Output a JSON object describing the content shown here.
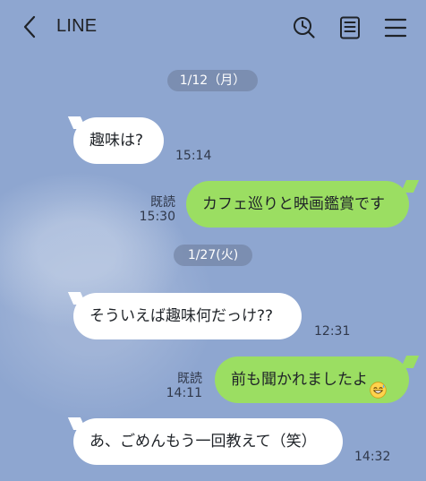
{
  "header": {
    "title": "LINE",
    "icons": {
      "back": "chevron-left-icon",
      "search": "clock-search-icon",
      "notes": "notes-icon",
      "menu": "menu-icon"
    }
  },
  "dates": [
    "1/12（月）",
    "1/27(火)"
  ],
  "messages": [
    {
      "text": "趣味は?",
      "time": "15:14"
    },
    {
      "text": "カフェ巡りと映画鑑賞です",
      "read": "既読",
      "time": "15:30"
    },
    {
      "text": "そういえば趣味何だっけ??",
      "time": "12:31"
    },
    {
      "text": "前も聞かれましたよ",
      "emoji": "grinning-sweat-emoji",
      "read": "既読",
      "time": "14:11"
    },
    {
      "text": "あ、ごめんもう一回教えて（笑）",
      "time": "14:32"
    }
  ],
  "colors": {
    "background": "#8ea6d0",
    "outgoing_bubble": "#9bde62",
    "incoming_bubble": "#ffffff",
    "date_pill": "#7485a5"
  }
}
